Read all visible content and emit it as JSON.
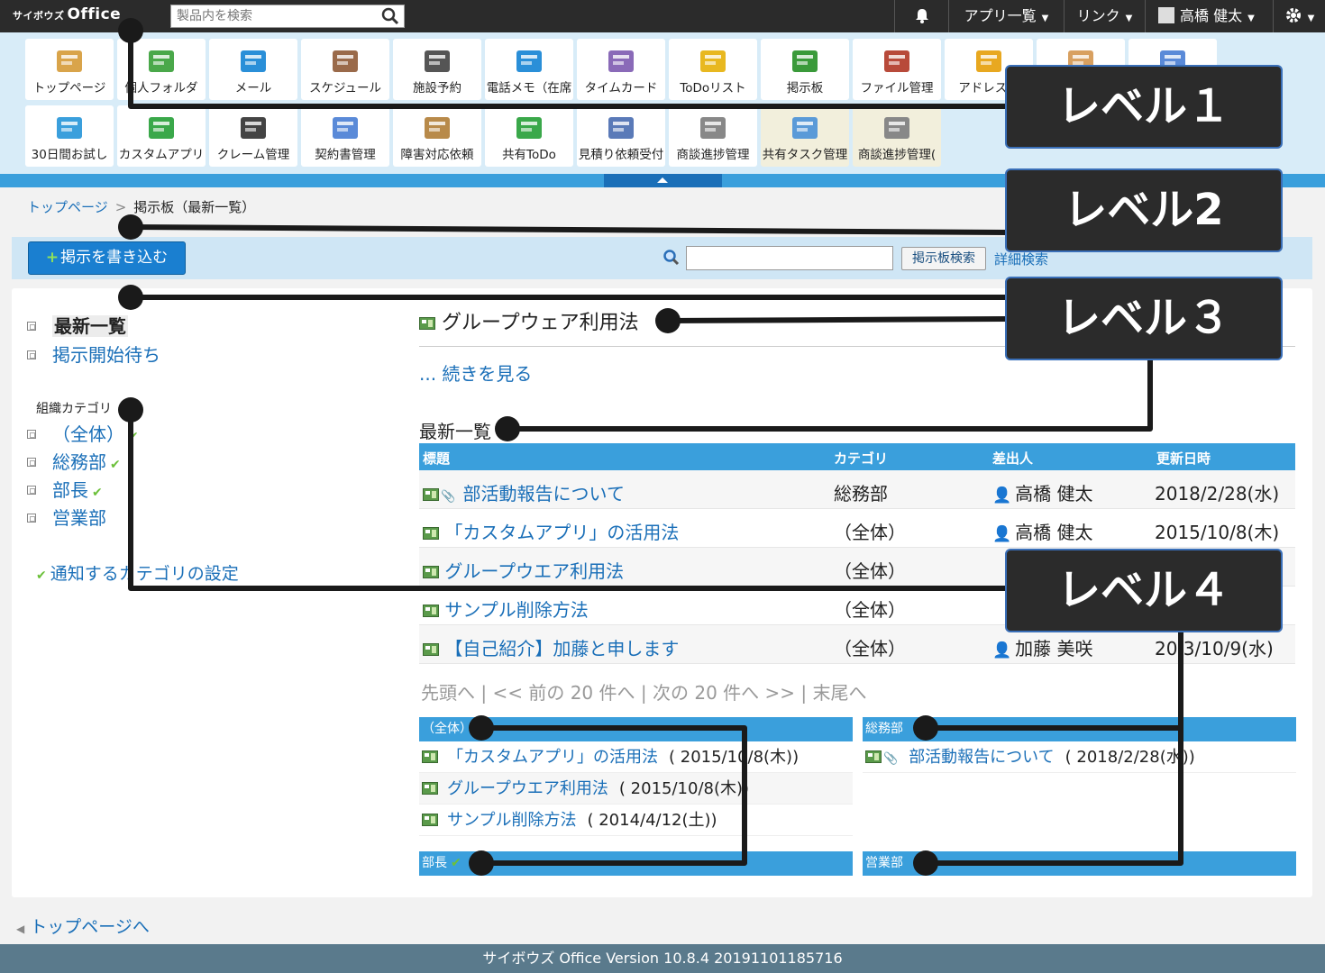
{
  "header": {
    "logo_small": "サイボウズ",
    "logo_main": "Office",
    "search_placeholder": "製品内を検索",
    "apps_label": "アプリ一覧",
    "link_label": "リンク",
    "user_name": "高橋 健太"
  },
  "apps": {
    "row1": [
      {
        "label": "トップページ",
        "icon": "home-icon",
        "color": "#d9a44a"
      },
      {
        "label": "個人フォルダ",
        "icon": "folder-icon",
        "color": "#4aa84a"
      },
      {
        "label": "メール",
        "icon": "mail-icon",
        "color": "#2a8fd8"
      },
      {
        "label": "スケジュール",
        "icon": "calendar-icon",
        "color": "#9a6a4a"
      },
      {
        "label": "施設予約",
        "icon": "facility-icon",
        "color": "#555555"
      },
      {
        "label": "電話メモ（在席",
        "icon": "phone-memo-icon",
        "color": "#2a8fd8"
      },
      {
        "label": "タイムカード",
        "icon": "timecard-icon",
        "color": "#8a6ab8"
      },
      {
        "label": "ToDoリスト",
        "icon": "todo-icon",
        "color": "#e8b820"
      },
      {
        "label": "掲示板",
        "icon": "bulletin-board-icon",
        "color": "#3a9a3a"
      },
      {
        "label": "ファイル管理",
        "icon": "file-icon",
        "color": "#b84a3a"
      },
      {
        "label": "アドレス帳",
        "icon": "address-book-icon",
        "color": "#e8a820"
      },
      {
        "label": "",
        "icon": "user-icon",
        "color": "#d8a060"
      },
      {
        "label": "",
        "icon": "users-icon",
        "color": "#5a8ad8"
      }
    ],
    "row2": [
      {
        "label": "30日間お試し",
        "icon": "free-trial-icon",
        "color": "#3a9fdc"
      },
      {
        "label": "カスタムアプリ",
        "icon": "blocks-icon",
        "color": "#3aa84a"
      },
      {
        "label": "クレーム管理",
        "icon": "headset-icon",
        "color": "#444444"
      },
      {
        "label": "契約書管理",
        "icon": "contract-folder-icon",
        "color": "#5a8ad8"
      },
      {
        "label": "障害対応依頼",
        "icon": "box-icon",
        "color": "#b88a4a"
      },
      {
        "label": "共有ToDo",
        "icon": "shared-todo-icon",
        "color": "#3aa84a"
      },
      {
        "label": "見積り依頼受付",
        "icon": "document-icon",
        "color": "#5a7ab8"
      },
      {
        "label": "商談進捗管理",
        "icon": "briefcase-icon",
        "color": "#888888"
      },
      {
        "label": "共有タスク管理",
        "icon": "clipboard-icon",
        "color": "#5a9ad8",
        "tinted": true
      },
      {
        "label": "商談進捗管理(",
        "icon": "briefcase-icon",
        "color": "#888888",
        "tinted": true
      }
    ]
  },
  "breadcrumb": {
    "home": "トップページ",
    "current": "掲示板（最新一覧）"
  },
  "toolbar": {
    "post_button": "掲示を書き込む",
    "search_button": "掲示板検索",
    "advanced_search": "詳細検索"
  },
  "sidebar": {
    "latest": "最新一覧",
    "waiting": "掲示開始待ち",
    "org_category": "組織カテゴリ",
    "categories": [
      "（全体）",
      "総務部",
      "部長",
      "営業部"
    ],
    "notify_setting": "通知するカテゴリの設定"
  },
  "featured": {
    "title": "グループウェア利用法",
    "more": "... 続きを見る"
  },
  "latest": {
    "title": "最新一覧",
    "columns": [
      "標題",
      "カテゴリ",
      "差出人",
      "更新日時"
    ],
    "rows": [
      {
        "title": "部活動報告について",
        "category": "総務部",
        "user": "高橋 健太",
        "date": "2018/2/28(水)",
        "attach": true
      },
      {
        "title": "「カスタムアプリ」の活用法",
        "category": "（全体）",
        "user": "高橋 健太",
        "date": "2015/10/8(木)",
        "attach": false
      },
      {
        "title": "グループウエア利用法",
        "category": "（全体）",
        "user": "",
        "date": "",
        "attach": false
      },
      {
        "title": "サンプル削除方法",
        "category": "（全体）",
        "user": "",
        "date": "",
        "attach": false
      },
      {
        "title": "【自己紹介】加藤と申します",
        "category": "（全体）",
        "user": "加藤 美咲",
        "date": "20 3/10/9(水)",
        "attach": false
      }
    ]
  },
  "pager": {
    "first": "先頭へ",
    "prev": "<< 前の 20 件へ",
    "next": "次の 20 件へ >>",
    "last": "末尾へ",
    "sep": "|"
  },
  "category_boxes": {
    "all": {
      "name": "（全体）",
      "items": [
        {
          "title": "「カスタムアプリ」の活用法",
          "date": "( 2015/10/8(木))"
        },
        {
          "title": "グループウエア利用法",
          "date": "( 2015/10/8(木))"
        },
        {
          "title": "サンプル削除方法",
          "date": "( 2014/4/12(土))"
        }
      ]
    },
    "soumu": {
      "name": "総務部",
      "items": [
        {
          "title": "部活動報告について",
          "date": "( 2018/2/28(水))"
        }
      ]
    },
    "bucho": {
      "name": "部長"
    },
    "eigyo": {
      "name": "営業部"
    }
  },
  "back_to_top": "トップページへ",
  "footer": "サイボウズ Office Version 10.8.4 20191101185716",
  "annotations": {
    "level1": "レベル１",
    "level2": "レベル2",
    "level3": "レベル３",
    "level4": "レベル４"
  },
  "colors": {
    "accent": "#3a9fdc",
    "link": "#1a6fb8",
    "topbar": "#2b2b2b",
    "footer": "#5a7a8c",
    "annotation_box": "#2b2b2b",
    "annotation_line": "#1a1a1a"
  }
}
